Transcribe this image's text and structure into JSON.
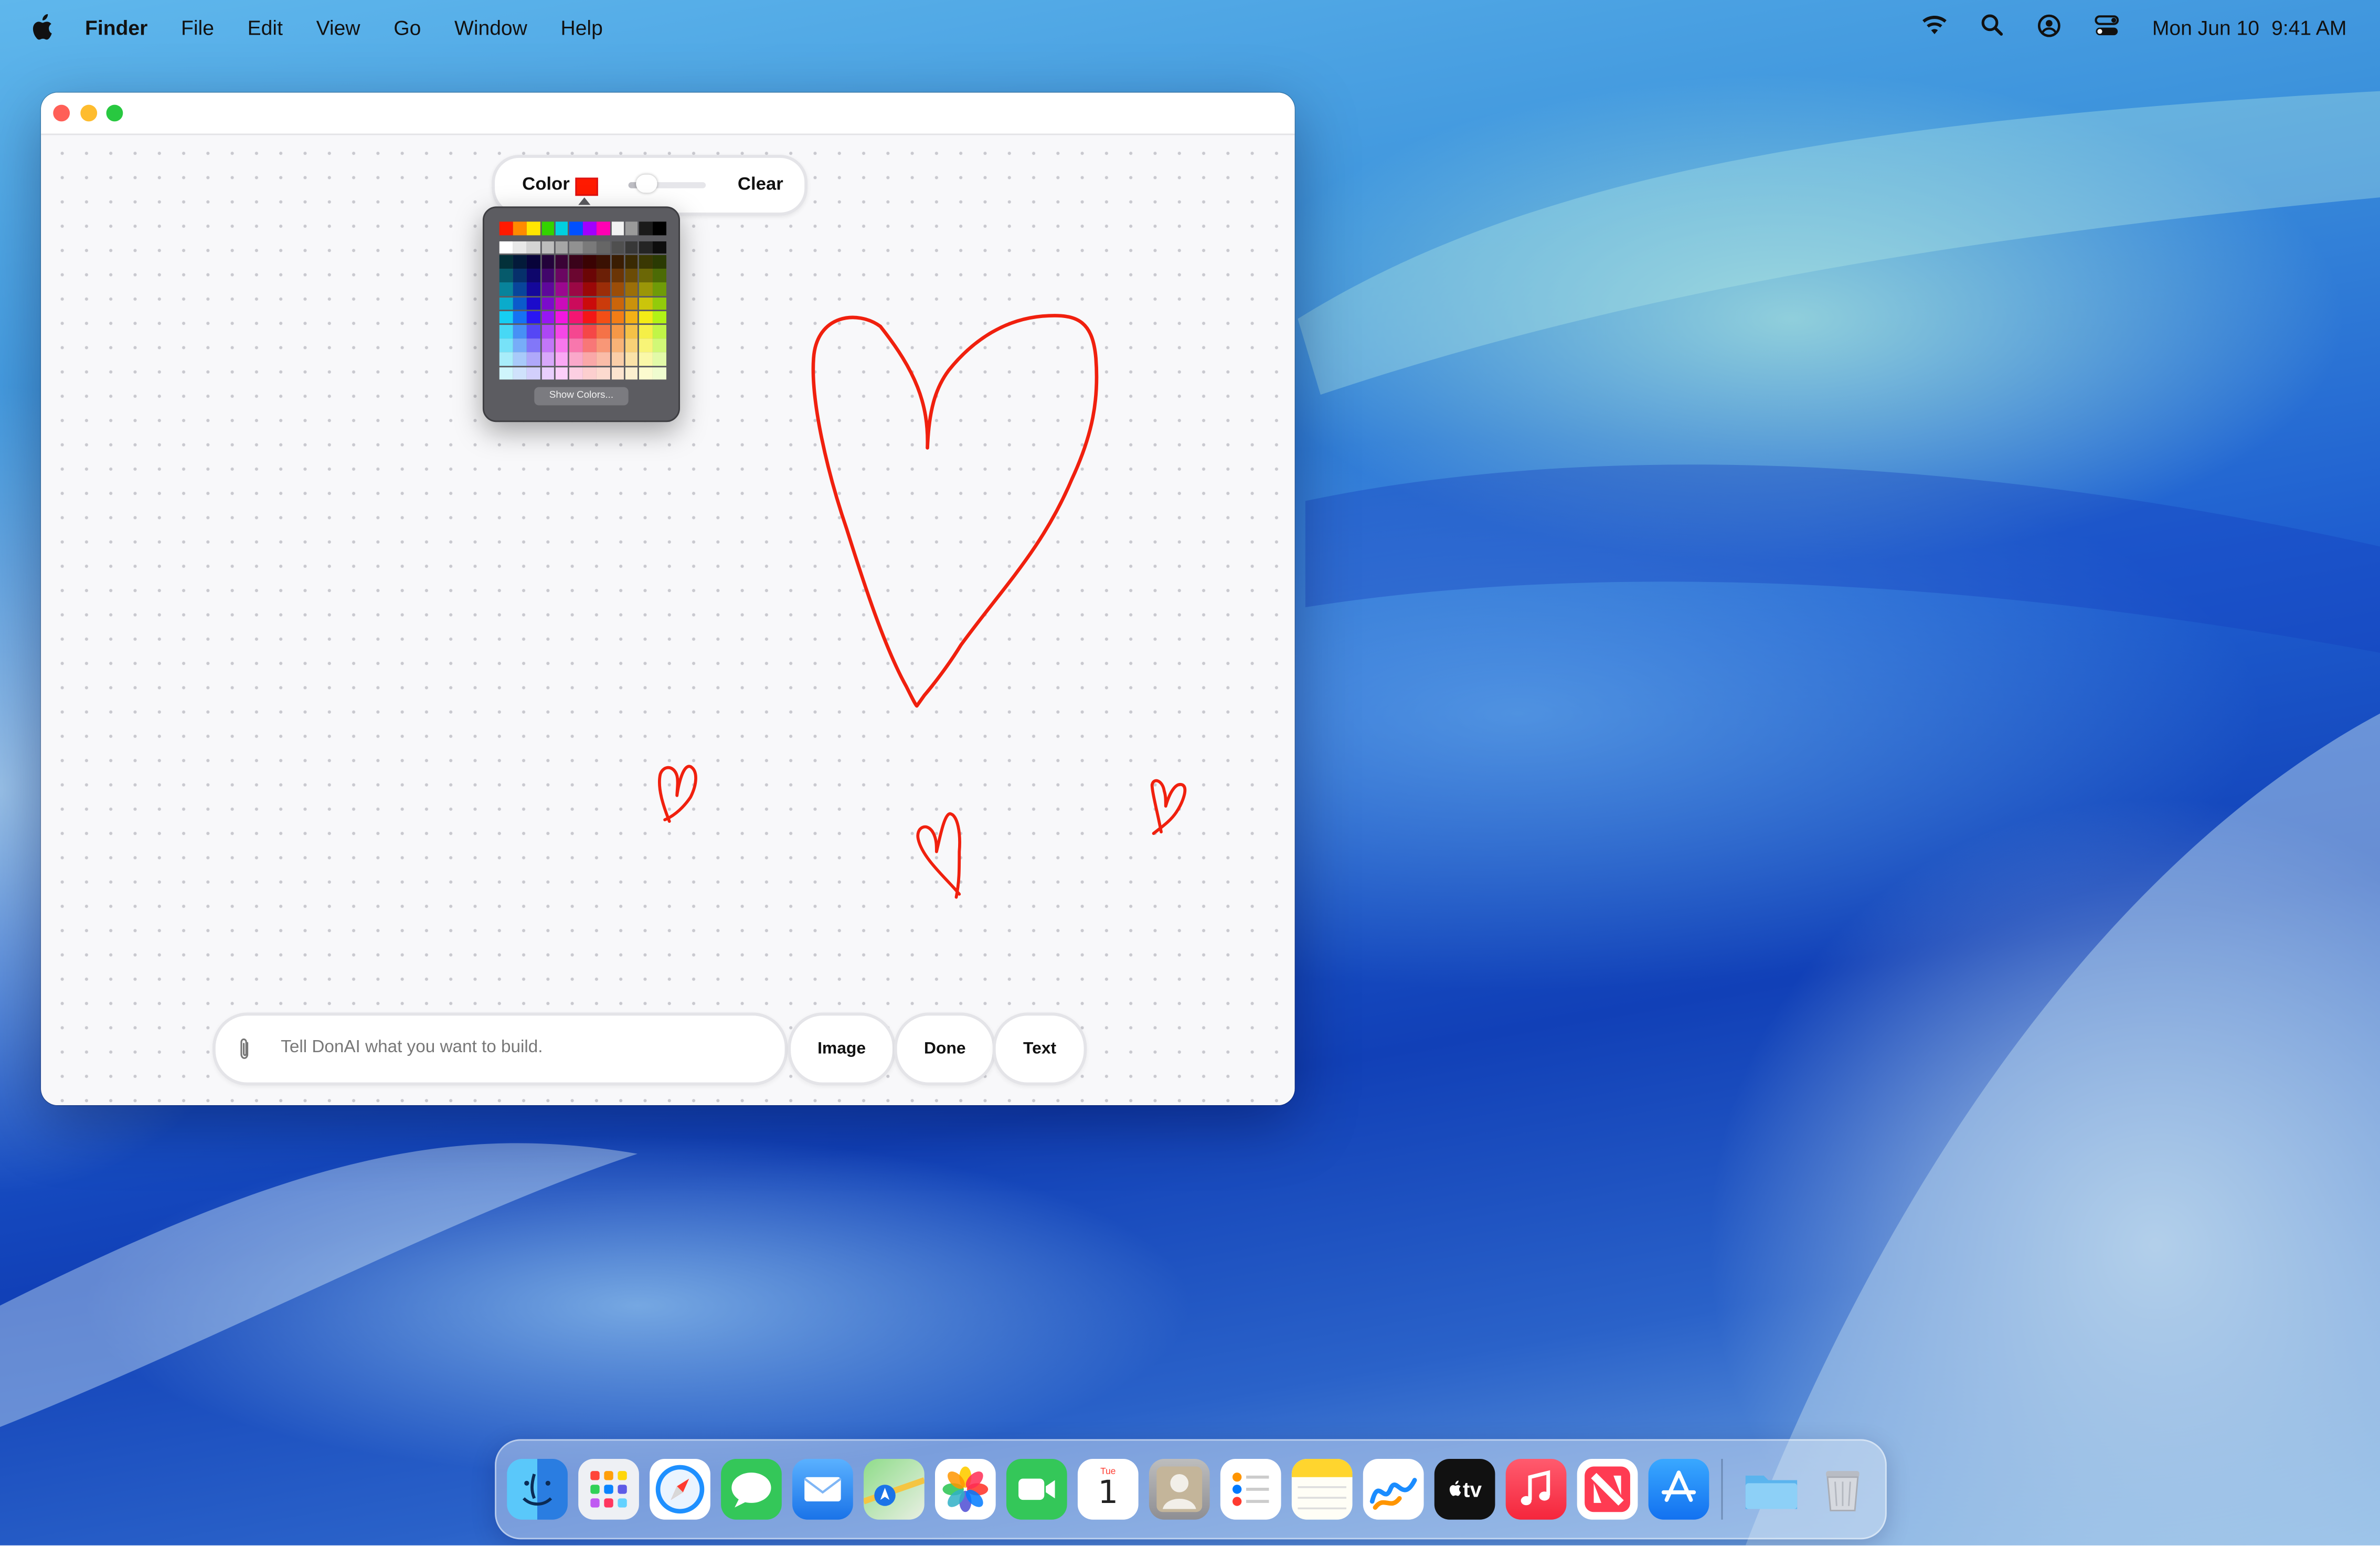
{
  "menubar": {
    "app_name": "Finder",
    "menus": [
      "File",
      "Edit",
      "View",
      "Go",
      "Window",
      "Help"
    ],
    "status_icons": [
      "wifi-icon",
      "search-icon",
      "user-account-icon",
      "control-center-icon"
    ],
    "date": "Mon Jun 10",
    "time": "9:41 AM"
  },
  "window": {
    "toolbar": {
      "color_label": "Color",
      "selected_color": "#ff1a00",
      "clear_label": "Clear"
    },
    "color_palette": {
      "show_colors_label": "Show Colors..."
    },
    "prompt": {
      "placeholder": "Tell DonAI what you want to build.",
      "buttons": [
        "Image",
        "Done",
        "Text"
      ]
    }
  },
  "dock": {
    "apps": [
      "Finder",
      "Launchpad",
      "Safari",
      "Messages",
      "Mail",
      "Maps",
      "Photos",
      "FaceTime",
      "Calendar",
      "Contacts",
      "Reminders",
      "Notes",
      "Freeform",
      "TV",
      "Music",
      "News",
      "App Store",
      "Downloads",
      "Trash"
    ],
    "calendar": {
      "month": "Tue",
      "day": "1"
    },
    "tv_label": "tv"
  }
}
